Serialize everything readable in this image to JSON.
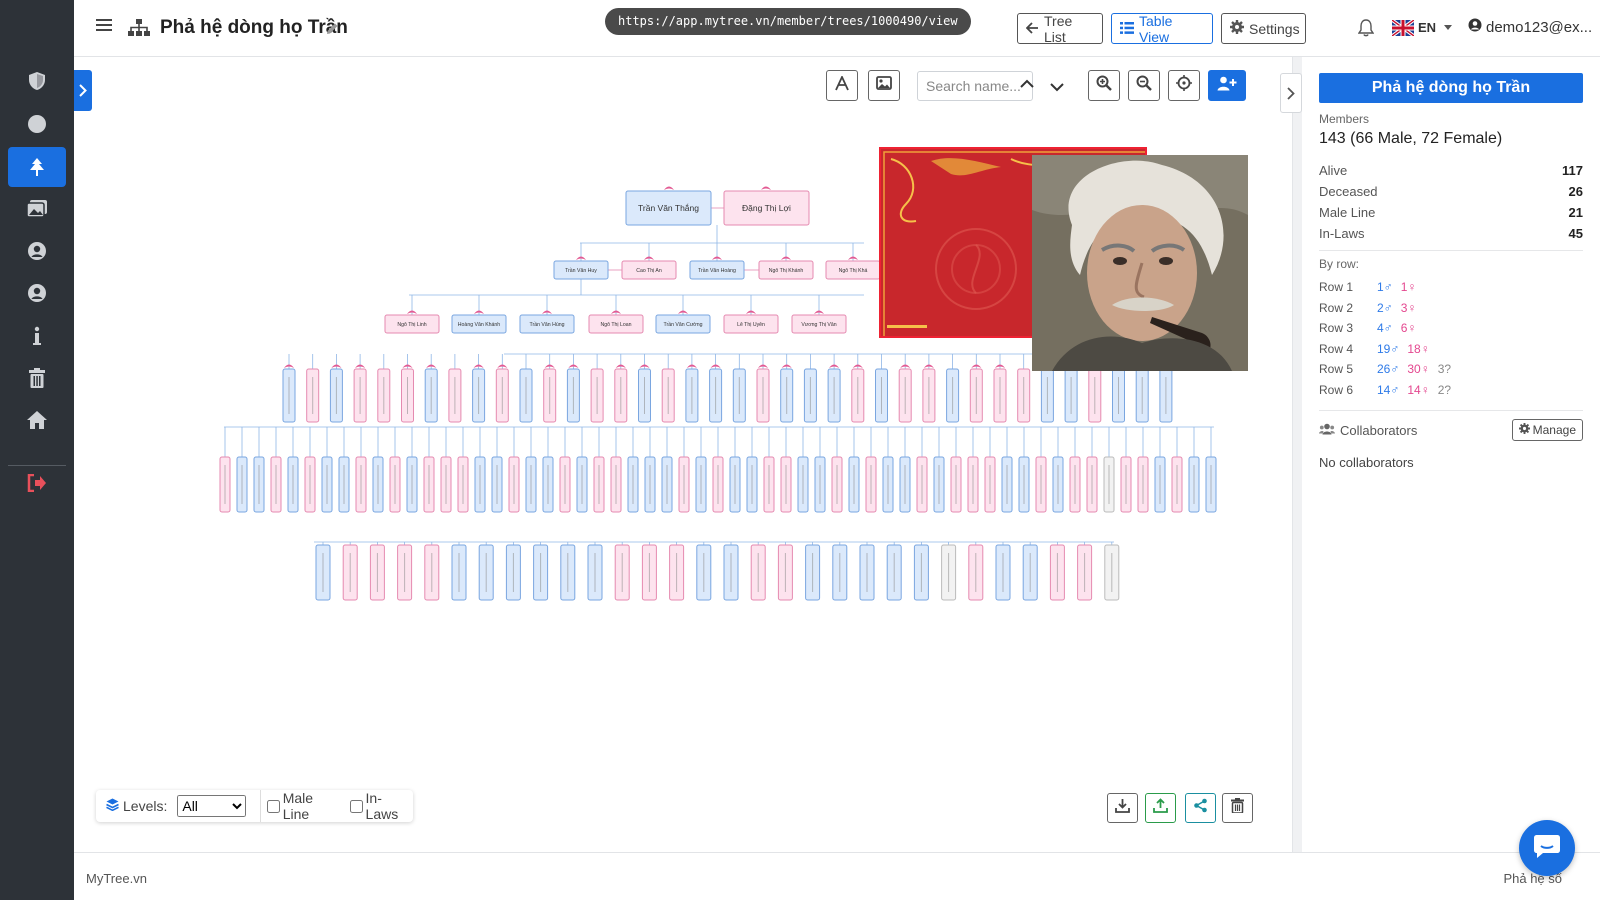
{
  "header": {
    "title": "Phả hệ dòng họ Trần",
    "url": "https://app.mytree.vn/member/trees/1000490/view",
    "tree_list_label": "Tree List",
    "table_view_label": "Table View",
    "settings_label": "Settings",
    "language": "EN",
    "user": "demo123@ex..."
  },
  "sidebar": {
    "items": [
      {
        "name": "shield-icon"
      },
      {
        "name": "circle-icon"
      },
      {
        "name": "tree-icon",
        "active": true
      },
      {
        "name": "images-icon"
      },
      {
        "name": "user-circle-icon"
      },
      {
        "name": "user-circle-icon-2"
      },
      {
        "name": "info-icon"
      },
      {
        "name": "trash-icon"
      },
      {
        "name": "home-icon"
      },
      {
        "name": "logout-icon"
      }
    ]
  },
  "toolbar": {
    "search_placeholder": "Search name..."
  },
  "tree": {
    "gen1": [
      "Trần Văn Thắng",
      "Đặng Thị Lợi"
    ],
    "gen2": [
      "Trần Văn Huy",
      "Cao Thị An",
      "Trần Văn Hoàng",
      "Ngô Thị Khánh",
      "Ngô Thị Khá"
    ],
    "gen3": [
      "Ngô Thị Linh",
      "Hoàng Văn Khánh",
      "Trần Văn Hùng",
      "Ngô Thị Loan",
      "Trần Văn Cường",
      "Lê Thị Uyên",
      "Vương Thị Vân"
    ]
  },
  "bottom_controls": {
    "levels_label": "Levels:",
    "levels_value": "All",
    "male_line_label": "Male Line",
    "in_laws_label": "In-Laws"
  },
  "panel": {
    "title": "Phả hệ dòng họ Trần",
    "members_label": "Members",
    "members_value": "143 (66 Male, 72 Female)",
    "stats": [
      {
        "label": "Alive",
        "value": "117"
      },
      {
        "label": "Deceased",
        "value": "26"
      },
      {
        "label": "Male Line",
        "value": "21"
      },
      {
        "label": "In-Laws",
        "value": "45"
      }
    ],
    "by_row_label": "By row:",
    "rows": [
      {
        "label": "Row 1",
        "male": "1♂",
        "female": "1♀",
        "unknown": ""
      },
      {
        "label": "Row 2",
        "male": "2♂",
        "female": "3♀",
        "unknown": ""
      },
      {
        "label": "Row 3",
        "male": "4♂",
        "female": "6♀",
        "unknown": ""
      },
      {
        "label": "Row 4",
        "male": "19♂",
        "female": "18♀",
        "unknown": ""
      },
      {
        "label": "Row 5",
        "male": "26♂",
        "female": "30♀",
        "unknown": "3?"
      },
      {
        "label": "Row 6",
        "male": "14♂",
        "female": "14♀",
        "unknown": "2?"
      }
    ],
    "collaborators_label": "Collaborators",
    "manage_label": "Manage",
    "no_collaborators": "No collaborators"
  },
  "footer": {
    "left": "MyTree.vn",
    "right": "Phả hệ số"
  },
  "colors": {
    "accent": "#1a6fe0",
    "sidebar_bg": "#2d3238",
    "male_fill": "#dbe9fb",
    "male_border": "#7aa6e0",
    "female_fill": "#fde3ee",
    "female_border": "#e58ab0",
    "unknown_fill": "#f2f2f2"
  }
}
